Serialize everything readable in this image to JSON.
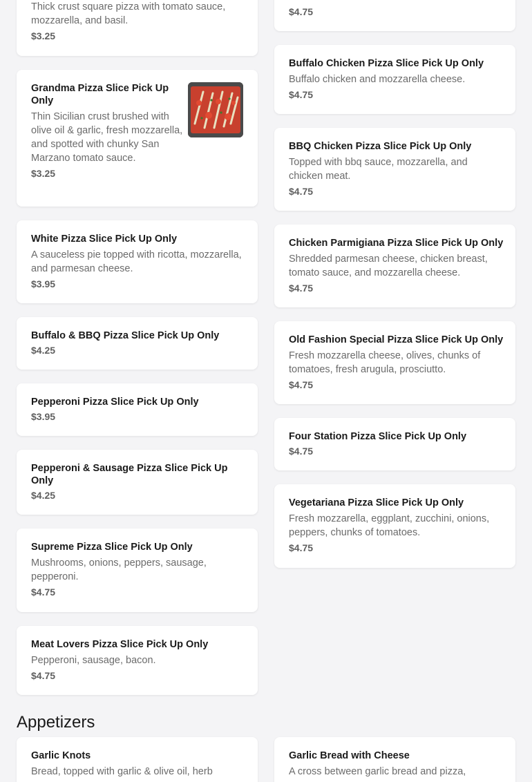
{
  "left_column": [
    {
      "desc": "Thick crust square pizza with tomato sauce, mozzarella, and basil.",
      "price": "$3.25"
    },
    {
      "name": "Grandma Pizza Slice Pick Up Only",
      "desc": "Thin Sicilian crust brushed with olive oil & garlic, fresh mozzarella, and spotted with chunky San Marzano tomato sauce.",
      "price": "$3.25",
      "image": "grandma-pizza-photo"
    },
    {
      "name": "White Pizza Slice Pick Up Only",
      "desc": "A sauceless pie topped with ricotta, mozzarella, and parmesan cheese.",
      "price": "$3.95"
    },
    {
      "name": "Buffalo & BBQ Pizza Slice Pick Up Only",
      "price": "$4.25"
    },
    {
      "name": "Pepperoni Pizza Slice Pick Up Only",
      "price": "$3.95"
    },
    {
      "name": "Pepperoni & Sausage Pizza Slice Pick Up Only",
      "price": "$4.25"
    },
    {
      "name": "Supreme Pizza Slice Pick Up Only",
      "desc": "Mushrooms, onions, peppers, sausage, pepperoni.",
      "price": "$4.75"
    },
    {
      "name": "Meat Lovers Pizza Slice Pick Up Only",
      "desc": "Pepperoni, sausage, bacon.",
      "price": "$4.75"
    }
  ],
  "right_column": [
    {
      "price": "$4.75"
    },
    {
      "name": "Buffalo Chicken Pizza Slice Pick Up Only",
      "desc": "Buffalo chicken and mozzarella cheese.",
      "price": "$4.75"
    },
    {
      "name": "BBQ Chicken Pizza Slice Pick Up Only",
      "desc": "Topped with bbq sauce, mozzarella, and chicken meat.",
      "price": "$4.75"
    },
    {
      "name": "Chicken Parmigiana Pizza Slice Pick Up Only",
      "desc": "Shredded parmesan cheese, chicken breast, tomato sauce, and mozzarella cheese.",
      "price": "$4.75"
    },
    {
      "name": "Old Fashion Special Pizza Slice Pick Up Only",
      "desc": "Fresh mozzarella cheese, olives, chunks of tomatoes, fresh arugula, prosciutto.",
      "price": "$4.75"
    },
    {
      "name": "Four Station Pizza Slice Pick Up Only",
      "price": "$4.75"
    },
    {
      "name": "Vegetariana Pizza Slice Pick Up Only",
      "desc": "Fresh mozzarella, eggplant, zucchini, onions, peppers, chunks of tomatoes.",
      "price": "$4.75"
    }
  ],
  "appetizers": {
    "title": "Appetizers",
    "items": [
      {
        "name": "Garlic Knots",
        "desc": "Bread, topped with garlic & olive oil, herb"
      },
      {
        "name": "Garlic Bread with Cheese",
        "desc": "A cross between garlic bread and pizza,"
      }
    ]
  }
}
